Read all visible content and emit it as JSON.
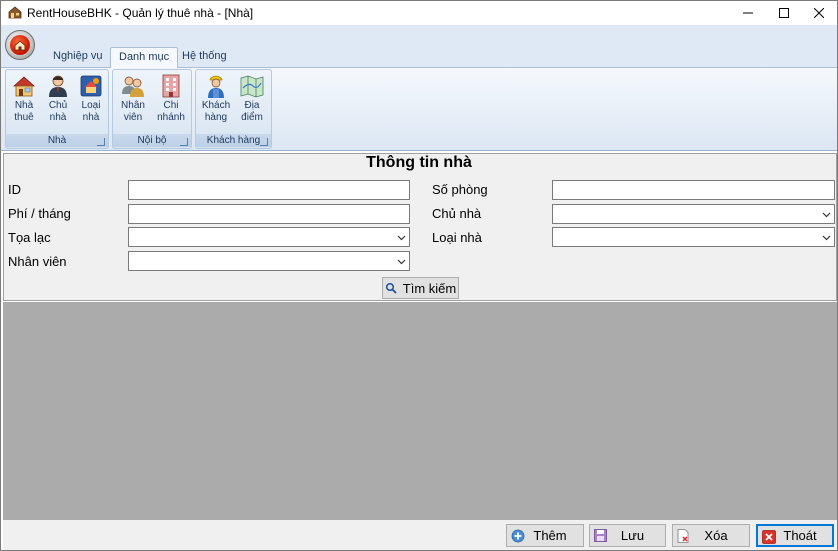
{
  "window": {
    "title": "RentHouseBHK - Quản lý thuê nhà - [Nhà]"
  },
  "ribbon": {
    "tabs": [
      {
        "label": "Nghiệp vụ"
      },
      {
        "label": "Danh mục"
      },
      {
        "label": "Hệ thống"
      }
    ],
    "active_tab": "Danh mục",
    "groups": {
      "nha": {
        "label": "Nhà",
        "buttons": [
          {
            "label": "Nhà\nthuê",
            "icon": "house-rent-icon"
          },
          {
            "label": "Chủ\nnhà",
            "icon": "owner-icon"
          },
          {
            "label": "Loại\nnhà",
            "icon": "house-type-icon"
          }
        ]
      },
      "noibo": {
        "label": "Nội bộ",
        "buttons": [
          {
            "label": "Nhân\nviên",
            "icon": "employees-icon"
          },
          {
            "label": "Chi\nnhánh",
            "icon": "branch-icon"
          }
        ]
      },
      "khachhang": {
        "label": "Khách hàng",
        "buttons": [
          {
            "label": "Khách\nhàng",
            "icon": "customer-icon"
          },
          {
            "label": "Địa\nđiểm",
            "icon": "map-icon"
          }
        ]
      }
    }
  },
  "form": {
    "title": "Thông tin nhà",
    "fields": {
      "id": {
        "label": "ID",
        "value": ""
      },
      "phi_thang": {
        "label": "Phí / tháng",
        "value": ""
      },
      "toa_lac": {
        "label": "Tọa lạc",
        "value": ""
      },
      "nhan_vien": {
        "label": "Nhân viên",
        "value": ""
      },
      "so_phong": {
        "label": "Số phòng",
        "value": ""
      },
      "chu_nha": {
        "label": "Chủ nhà",
        "value": ""
      },
      "loai_nha": {
        "label": "Loại nhà",
        "value": ""
      }
    },
    "search_label": "Tìm kiếm"
  },
  "actions": {
    "them": "Thêm",
    "luu": "Lưu",
    "xoa": "Xóa",
    "thoat": "Thoát"
  },
  "colors": {
    "ribbon_bg": "#dfe9f5",
    "grid_bg": "#ababab",
    "focus_border": "#0078d7"
  }
}
